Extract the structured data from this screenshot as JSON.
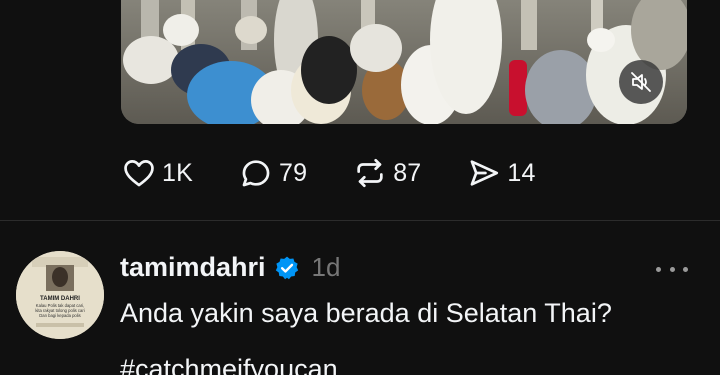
{
  "post_one": {
    "media": {
      "type": "video",
      "mute_icon": "speaker-muted-icon"
    },
    "actions": {
      "like_count": "1K",
      "reply_count": "79",
      "repost_count": "87",
      "share_count": "14",
      "like_icon": "heart-icon",
      "reply_icon": "speech-bubble-icon",
      "repost_icon": "repost-icon",
      "share_icon": "send-icon"
    }
  },
  "post_two": {
    "username": "tamimdahri",
    "verified": true,
    "time_ago": "1d",
    "text": "Anda yakin saya berada di Selatan Thai?",
    "hashtag": "#catchmeifyoucan",
    "avatar": {
      "caption_line1": "TAMIM DAHRI",
      "caption_line2": "Kalau Polis tak dapat cari,",
      "caption_line3": "kita rakyat tolong polis cari",
      "caption_line4": "Dan bagi kepada polis"
    }
  },
  "colors": {
    "background": "#101010",
    "text": "#f3f5f7",
    "muted": "#777777",
    "verified_blue": "#0095f6",
    "repost_red": "#c8102e"
  }
}
